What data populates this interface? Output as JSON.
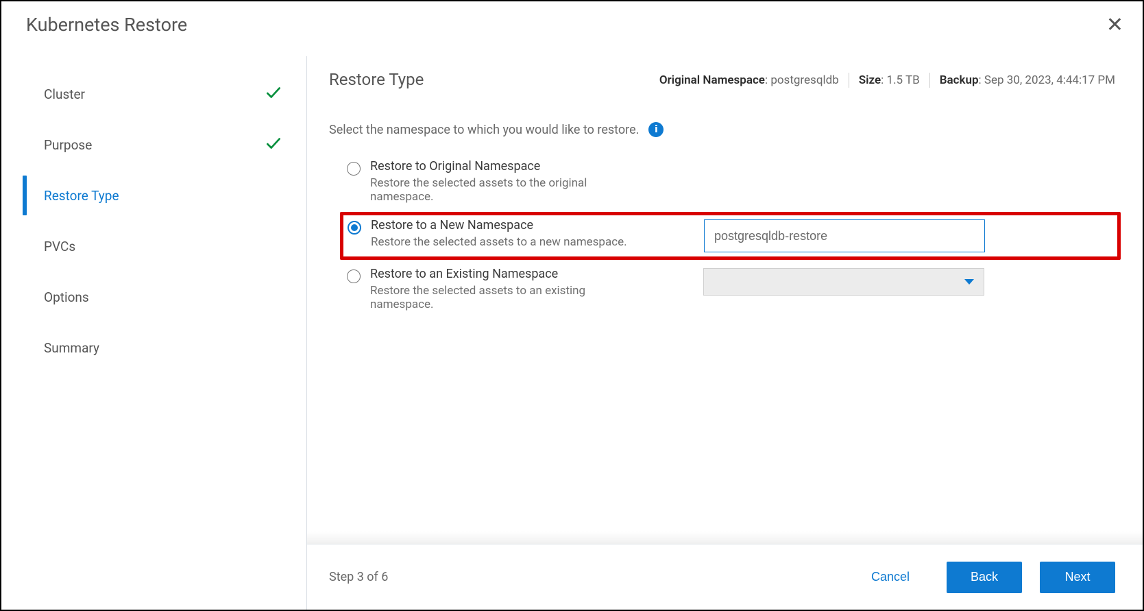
{
  "dialog": {
    "title": "Kubernetes Restore"
  },
  "sidebar": {
    "steps": [
      {
        "label": "Cluster",
        "state": "done"
      },
      {
        "label": "Purpose",
        "state": "done"
      },
      {
        "label": "Restore Type",
        "state": "active"
      },
      {
        "label": "PVCs",
        "state": "pending"
      },
      {
        "label": "Options",
        "state": "pending"
      },
      {
        "label": "Summary",
        "state": "pending"
      }
    ]
  },
  "header": {
    "page_title": "Restore Type",
    "original_namespace_label": "Original Namespace",
    "original_namespace_value": "postgresqldb",
    "size_label": "Size",
    "size_value": "1.5 TB",
    "backup_label": "Backup",
    "backup_value": "Sep 30, 2023, 4:44:17 PM"
  },
  "instruction": "Select the namespace to which you would like to restore.",
  "options": {
    "original": {
      "title": "Restore to Original Namespace",
      "desc": "Restore the selected assets to the original namespace."
    },
    "new": {
      "title": "Restore to a New Namespace",
      "desc": "Restore the selected assets to a new namespace.",
      "input_value": "postgresqldb-restore"
    },
    "existing": {
      "title": "Restore to an Existing Namespace",
      "desc": "Restore the selected assets to an existing namespace.",
      "selected": ""
    }
  },
  "footer": {
    "step_counter": "Step 3 of 6",
    "cancel": "Cancel",
    "back": "Back",
    "next": "Next"
  }
}
